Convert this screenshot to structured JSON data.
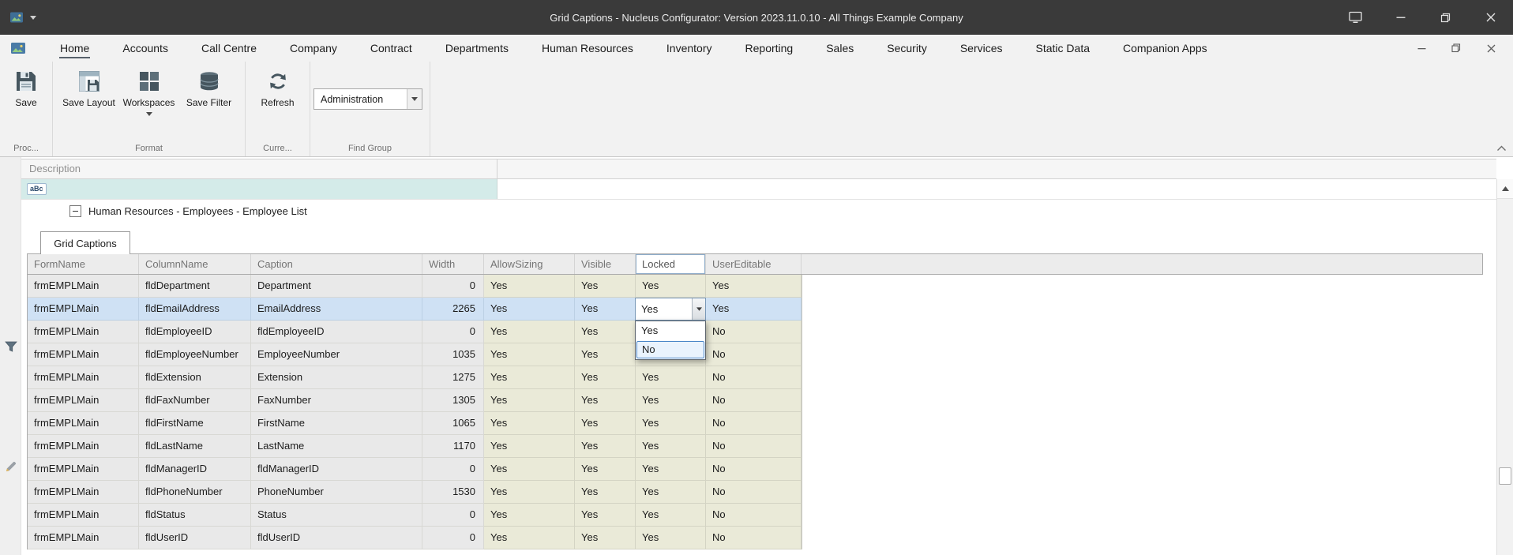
{
  "colors": {
    "titlebar": "#3a3a3a",
    "ribbon_bg": "#f2f2f2",
    "selection_blue": "#cfe1f4",
    "editable_column_tint": "#eaead8",
    "filter_cell_teal": "#d4ebe9",
    "dropdown_highlight_border": "#4a86c8"
  },
  "titlebar": {
    "title": "Grid Captions - Nucleus Configurator: Version 2023.11.0.10 - All Things Example Company"
  },
  "ribbon": {
    "tabs": [
      "Home",
      "Accounts",
      "Call Centre",
      "Company",
      "Contract",
      "Departments",
      "Human Resources",
      "Inventory",
      "Reporting",
      "Sales",
      "Security",
      "Services",
      "Static Data",
      "Companion Apps"
    ],
    "selected_tab": "Home",
    "groups": {
      "process": {
        "label": "Proc...",
        "save_label": "Save"
      },
      "format": {
        "label": "Format",
        "save_layout_label": "Save Layout",
        "workspaces_label": "Workspaces",
        "save_filter_label": "Save Filter"
      },
      "current": {
        "label": "Curre...",
        "refresh_label": "Refresh"
      },
      "find_group": {
        "label": "Find Group",
        "combo_value": "Administration"
      }
    }
  },
  "master_grid": {
    "column_header": "Description",
    "filter_icon_text": "aBc",
    "group_caption": "Human Resources - Employees - Employee List"
  },
  "detail_grid": {
    "tab_label": "Grid Captions",
    "columns": [
      "FormName",
      "ColumnName",
      "Caption",
      "Width",
      "AllowSizing",
      "Visible",
      "Locked",
      "UserEditable"
    ],
    "rows": [
      [
        "frmEMPLMain",
        "fldDepartment",
        "Department",
        "0",
        "Yes",
        "Yes",
        "Yes",
        "Yes"
      ],
      [
        "frmEMPLMain",
        "fldEmailAddress",
        "EmailAddress",
        "2265",
        "Yes",
        "Yes",
        "Yes",
        "Yes"
      ],
      [
        "frmEMPLMain",
        "fldEmployeeID",
        "fldEmployeeID",
        "0",
        "Yes",
        "Yes",
        "",
        "No"
      ],
      [
        "frmEMPLMain",
        "fldEmployeeNumber",
        "EmployeeNumber",
        "1035",
        "Yes",
        "Yes",
        "",
        "No"
      ],
      [
        "frmEMPLMain",
        "fldExtension",
        "Extension",
        "1275",
        "Yes",
        "Yes",
        "Yes",
        "No"
      ],
      [
        "frmEMPLMain",
        "fldFaxNumber",
        "FaxNumber",
        "1305",
        "Yes",
        "Yes",
        "Yes",
        "No"
      ],
      [
        "frmEMPLMain",
        "fldFirstName",
        "FirstName",
        "1065",
        "Yes",
        "Yes",
        "Yes",
        "No"
      ],
      [
        "frmEMPLMain",
        "fldLastName",
        "LastName",
        "1170",
        "Yes",
        "Yes",
        "Yes",
        "No"
      ],
      [
        "frmEMPLMain",
        "fldManagerID",
        "fldManagerID",
        "0",
        "Yes",
        "Yes",
        "Yes",
        "No"
      ],
      [
        "frmEMPLMain",
        "fldPhoneNumber",
        "PhoneNumber",
        "1530",
        "Yes",
        "Yes",
        "Yes",
        "No"
      ],
      [
        "frmEMPLMain",
        "fldStatus",
        "Status",
        "0",
        "Yes",
        "Yes",
        "Yes",
        "No"
      ],
      [
        "frmEMPLMain",
        "fldUserID",
        "fldUserID",
        "0",
        "Yes",
        "Yes",
        "Yes",
        "No"
      ]
    ],
    "selected_row": "fldEmailAddress",
    "editor": {
      "column": "Locked",
      "value": "Yes",
      "options": [
        "Yes",
        "No"
      ],
      "highlighted_option": "No"
    }
  }
}
